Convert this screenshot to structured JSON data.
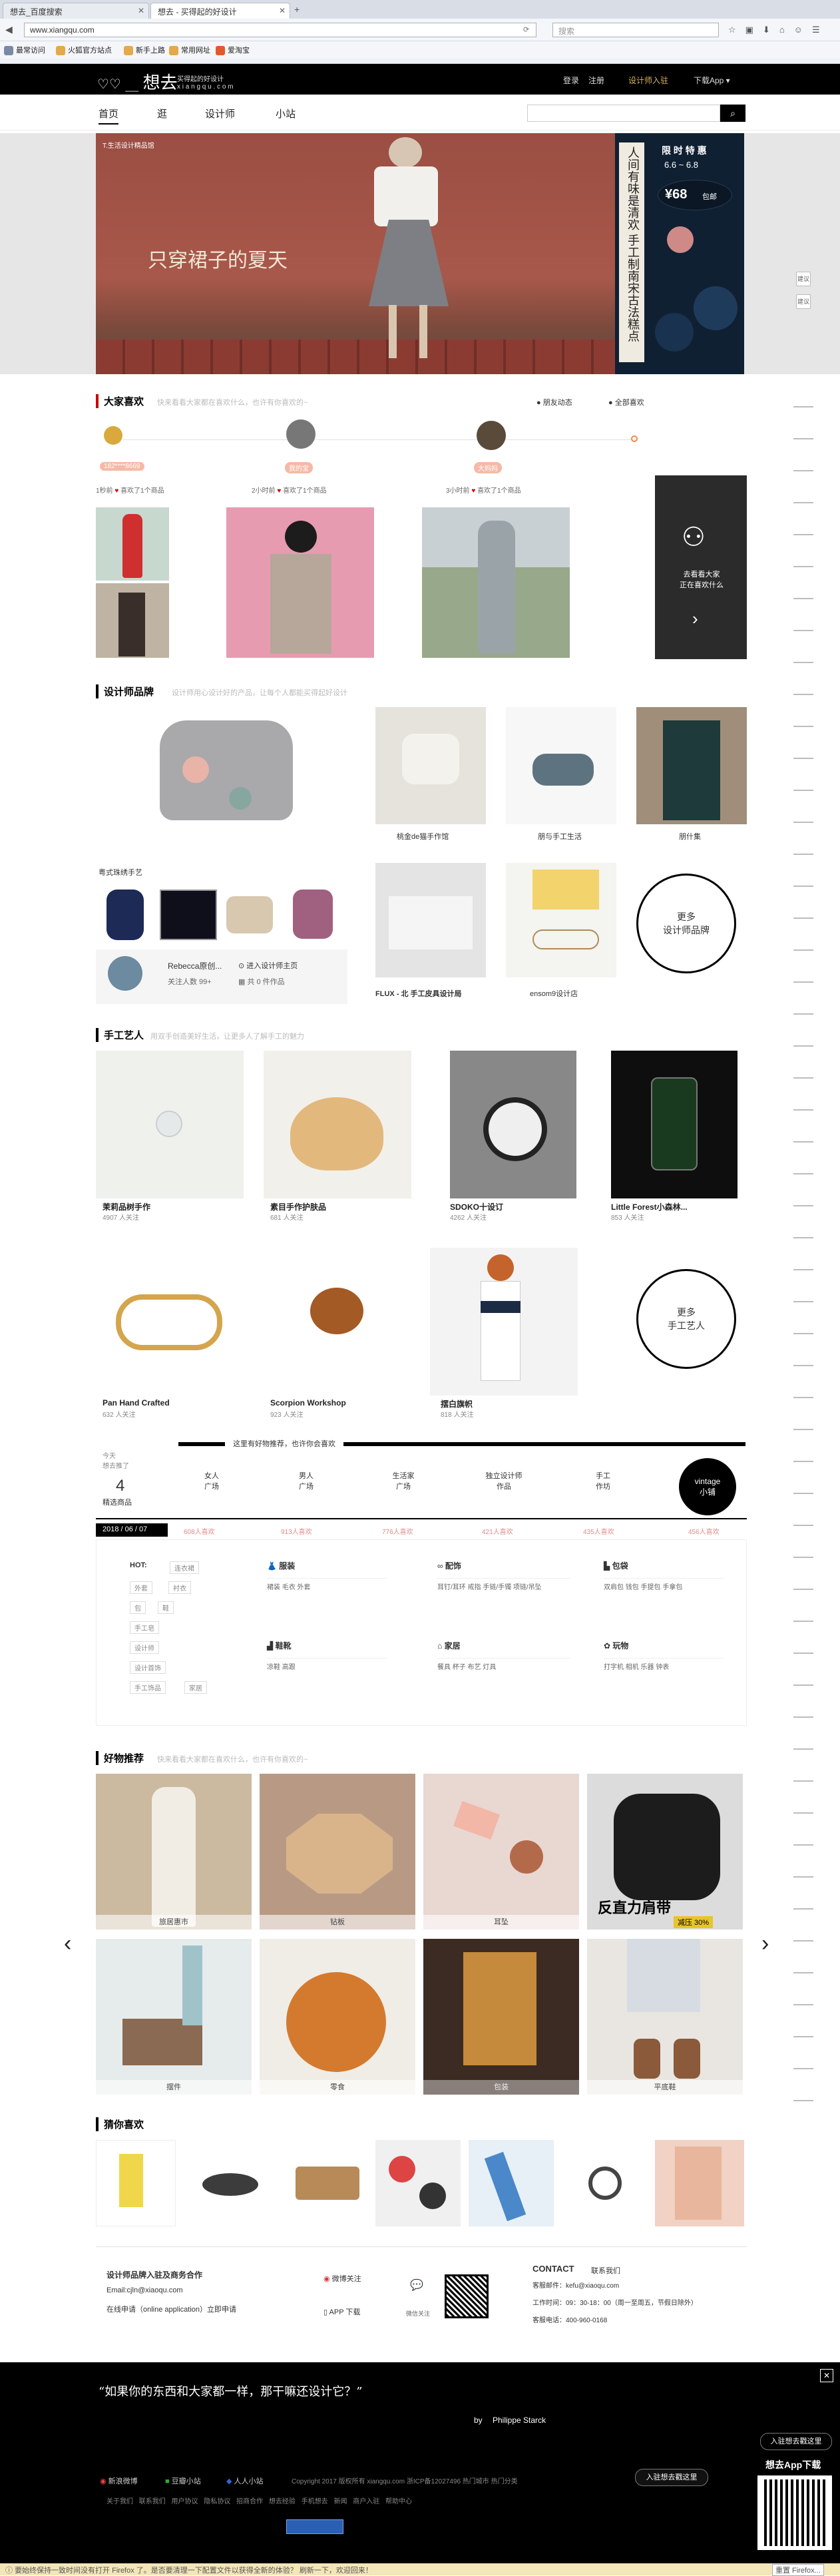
{
  "browser": {
    "tabs": [
      "想去_百度搜索",
      "想去 - 买得起的好设计"
    ],
    "url": "www.xiangqu.com",
    "search_placeholder": "搜索",
    "bookmarks": [
      "最常访问",
      "火狐官方站点",
      "新手上路",
      "常用网址",
      "爱淘宝"
    ]
  },
  "header": {
    "logo_text": "想去",
    "logo_tagline": "买得起的好设计",
    "logo_sub": "x i a n g q u . c o m",
    "links": [
      "登录",
      "注册",
      "设计师入驻",
      "下载App ▾"
    ]
  },
  "nav": {
    "items": [
      "首页",
      "逛",
      "设计师",
      "小站"
    ],
    "search_btn": "⌕"
  },
  "banner": {
    "left_caption": "只穿裙子的夏天",
    "brand": "T.生活设计精品馆",
    "side_title": "人间有味是清欢 手工制南宋古法糕点",
    "sale_title": "限 时 特 惠",
    "sale_dates": "6.6 ~ 6.8",
    "price": "¥68",
    "price_suffix": "包邮"
  },
  "likes": {
    "title": "大家喜欢",
    "subtitle": "快来看看大家都在喜欢什么，也许有你喜欢的~",
    "filters": [
      "朋友动态",
      "全部喜欢"
    ],
    "feed": [
      {
        "user": "182****8669",
        "when": "1秒前",
        "action": "喜欢了1个商品"
      },
      {
        "user": "我的宝",
        "when": "2小时前",
        "action": "喜欢了1个商品"
      },
      {
        "user": "大妈妈",
        "when": "3小时前",
        "action": "喜欢了1个商品"
      }
    ],
    "cta": "去看看大家\n正在喜欢什么"
  },
  "designers": {
    "title": "设计师品牌",
    "subtitle": "设计师用心设计好的产品，让每个人都能买得起好设计",
    "feature_name": "粤式珠绣手艺",
    "designer": "Rebecca原创...",
    "enter_shop": "进入设计师主页",
    "followers": "关注人数 99+",
    "items_count": "共 0 件作品",
    "brands": [
      "桃金de猫手作馆",
      "朋与手工生活",
      "朋什集",
      "FLUX - 北 手工皮具设计局",
      "ensom9设计店"
    ],
    "more": "更多\n设计师品牌"
  },
  "artisans": {
    "title": "手工艺人",
    "subtitle": "用双手创造美好生活，让更多人了解手工的魅力",
    "list": [
      {
        "name": "茉莉品树手作",
        "fans": "4907 人关注"
      },
      {
        "name": "素目手作护肤品",
        "fans": "681 人关注"
      },
      {
        "name": "SDOKO十设订",
        "fans": "4262 人关注"
      },
      {
        "name": "Little Forest小森林...",
        "fans": "853 人关注"
      },
      {
        "name": "Pan Hand Crafted",
        "fans": "632 人关注"
      },
      {
        "name": "Scorpion Workshop",
        "fans": "923 人关注"
      },
      {
        "name": "摆白旗帜",
        "fans": "818 人关注"
      }
    ],
    "more": "更多\n手工艺人"
  },
  "topics": {
    "banner": "这里有好物推荐，也许你会喜欢",
    "today_label": "今天\n想去推了",
    "today_count": "4",
    "today_unit": "精选商品",
    "categories": [
      "女人\n广场",
      "男人\n广场",
      "生活家\n广场",
      "独立设计师\n作品",
      "手工\n作坊",
      "vintage\n小铺"
    ],
    "date": "2018 / 06 / 07",
    "counts": [
      "608人喜欢",
      "913人喜欢",
      "776人喜欢",
      "421人喜欢",
      "435人喜欢",
      "456人喜欢"
    ],
    "hot_label": "HOT:",
    "hot_tags": [
      "连衣裙",
      "外套",
      "衬衣",
      "包",
      "鞋",
      "手工皂",
      "设计师",
      "设计首饰",
      "手工饰品",
      "家居"
    ],
    "groups": [
      {
        "name": "服装",
        "items": "裙装  毛衣  外套"
      },
      {
        "name": "配饰",
        "items": "耳钉/耳环  戒指  手链/手镯  项链/吊坠"
      },
      {
        "name": "包袋",
        "items": "双肩包  钱包  手提包  手拿包"
      },
      {
        "name": "鞋靴",
        "items": "凉鞋  高跟"
      },
      {
        "name": "家居",
        "items": "餐具  杯子  布艺  灯具"
      },
      {
        "name": "玩物",
        "items": "打字机  相机  乐器  钟表"
      }
    ]
  },
  "goods": {
    "title": "好物推荐",
    "subtitle": "快来看看大家都在喜欢什么，也许有你喜欢的~",
    "items": [
      "旅居惠市",
      "钻板",
      "耳坠",
      "反直力肩带",
      "摆件",
      "零食",
      "包装",
      "平底鞋"
    ],
    "promo_badge": "减压 30%"
  },
  "guess": {
    "title": "猜你喜欢"
  },
  "contact": {
    "title": "设计师品牌入驻及商务合作",
    "email": "Email:cjln@xiaoqu.com",
    "apply": "在线申请（online application）立即申请",
    "weibo": "微博关注",
    "weixin": "微信关注",
    "app": "APP 下载",
    "contact_title": "CONTACT",
    "contact_us": "联系我们",
    "service_email": "客服邮件：kefu@xiaoqu.com",
    "hours": "工作时间：09：30-18：00（周一至周五，节假日除外）",
    "phone": "客服电话：400-960-0168"
  },
  "footer": {
    "quote": "“如果你的东西和大家都一样，那干嘛还设计它？”",
    "author": "Philippe Starck",
    "by": "by",
    "social": [
      "新浪微博",
      "豆瓣小站",
      "人人小站"
    ],
    "copyright": "Copyright 2017 版权所有 xiangqu.com 浙ICP备12027496  热门城市  热门分类",
    "links": "关于我们  联系我们  用户协议  隐私协议  招商合作  想去经验  手机想去  新闻  商户入驻  帮助中心",
    "apply_btn": "入驻想去戳这里",
    "app_download": "想去App下载",
    "firefox_notice": "要始终保持一致时间没有打开 Firefox 了。是否要清理一下配置文件以获得全新的体验？ 刷新一下，欢迎回来！",
    "refresh_btn": "重置 Firefox..."
  },
  "side_tags": [
    "建议",
    "建议",
    "建议",
    "建议",
    "建议",
    "建议"
  ],
  "colors": {
    "brand_black": "#000000",
    "accent_red": "#c00000",
    "gold": "#d9b35c"
  }
}
